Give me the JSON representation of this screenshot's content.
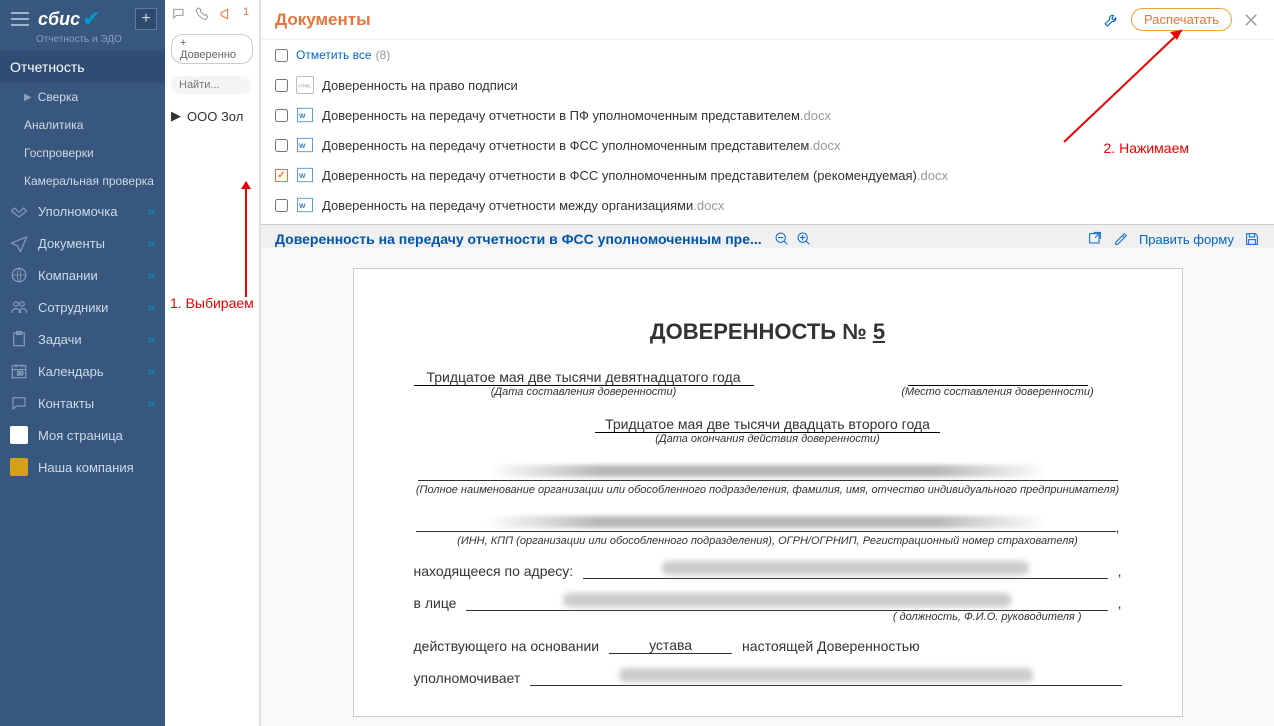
{
  "sidebar": {
    "logo": "сбис",
    "tagline": "Отчетность и ЭДО",
    "section": "Отчетность",
    "items": [
      {
        "label": "Сверка",
        "has_chevron": false,
        "sub": true,
        "tri": true
      },
      {
        "label": "Аналитика",
        "sub": true
      },
      {
        "label": "Госпроверки",
        "sub": true
      },
      {
        "label": "Камеральная проверка",
        "sub": true
      }
    ],
    "main_items": [
      {
        "icon": "handshake",
        "label": "Уполномочка",
        "chevron": true
      },
      {
        "icon": "send",
        "label": "Документы",
        "chevron": true
      },
      {
        "icon": "globe",
        "label": "Компании",
        "chevron": true
      },
      {
        "icon": "users",
        "label": "Сотрудники",
        "chevron": true
      },
      {
        "icon": "clipboard",
        "label": "Задачи",
        "chevron": true
      },
      {
        "icon": "calendar",
        "label": "Календарь",
        "chevron": true
      },
      {
        "icon": "chat",
        "label": "Контакты",
        "chevron": true
      },
      {
        "icon": "avatar",
        "label": "Моя страница"
      },
      {
        "icon": "logo",
        "label": "Наша компания"
      }
    ]
  },
  "midcol": {
    "add_button": "+ Доверенно",
    "search_placeholder": "Найти...",
    "org": "ООО Зол"
  },
  "docs": {
    "title": "Документы",
    "print_btn": "Распечатать",
    "select_all": "Отметить все",
    "count": "(8)",
    "list": [
      {
        "icon": "html",
        "name": "Доверенность на право подписи",
        "ext": ""
      },
      {
        "icon": "docx",
        "name": "Доверенность на передачу отчетности в ПФ уполномоченным представителем",
        "ext": ".docx"
      },
      {
        "icon": "docx",
        "name": "Доверенность на передачу отчетности в ФСС уполномоченным представителем",
        "ext": ".docx"
      },
      {
        "icon": "docx",
        "name": "Доверенность на передачу отчетности в ФСС уполномоченным представителем (рекомендуемая)",
        "ext": ".docx",
        "checked": true
      },
      {
        "icon": "docx",
        "name": "Доверенность на передачу отчетности между организациями",
        "ext": ".docx"
      }
    ],
    "preview_title": "Доверенность на передачу отчетности в ФСС уполномоченным пре...",
    "edit_form": "Править форму"
  },
  "document": {
    "title_prefix": "ДОВЕРЕННОСТЬ № ",
    "number": "5",
    "date1": "Тридцатое мая две тысячи девятнадцатого года",
    "caption1": "(Дата составления доверенности)",
    "caption1r": "(Место составления доверенности)",
    "date2": "Тридцатое мая две тысячи двадцать второго года",
    "caption2": "(Дата окончания действия доверенности)",
    "caption_org": "(Полное наименование организации или обособленного подразделения, фамилия, имя, отчество индивидуального предпринимателя)",
    "caption_inn": "(ИНН, КПП (организации или обособленного подразделения), ОГРН/ОГРНИП, Регистрационный номер страхователя)",
    "address_label": "находящееся по адресу:",
    "person_label": "в лице",
    "caption_person": "( должность, Ф.И.О. руководителя )",
    "basis_label": "действующего на основании",
    "basis_value": "устава",
    "basis_suffix": "настоящей Доверенностью",
    "auth_label": "уполномочивает"
  },
  "annotations": {
    "a1": "1. Выбираем",
    "a2": "2. Нажимаем"
  }
}
